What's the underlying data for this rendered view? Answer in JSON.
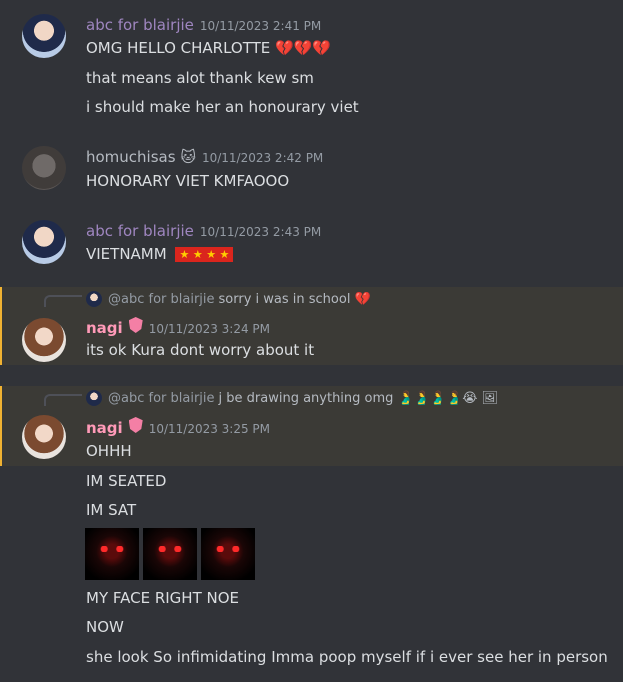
{
  "messages": [
    {
      "username": "abc for blairjie",
      "timestamp": "10/11/2023 2:41 PM",
      "lines": [
        "OMG HELLO CHARLOTTE 💔💔💔",
        "that means alot thank kew sm",
        "i should make her an honourary viet"
      ]
    },
    {
      "username": "homuchisas 🐱",
      "timestamp": "10/11/2023 2:42 PM",
      "lines": [
        "HONORARY VIET KMFAOOO"
      ]
    },
    {
      "username": "abc for blairjie",
      "timestamp": "10/11/2023 2:43 PM",
      "lines": [
        "VIETNAMM"
      ],
      "flag": "★ ★ ★ ★"
    },
    {
      "reply_mention": "@abc for blairjie",
      "reply_text": "sorry i was in school 💔",
      "username": "nagi",
      "timestamp": "10/11/2023 3:24 PM",
      "lines": [
        "its ok Kura dont worry about it"
      ]
    },
    {
      "reply_mention": "@abc for blairjie",
      "reply_text": "j be drawing anything omg 🫃🫃🫃🫃😭 🖼",
      "username": "nagi",
      "timestamp": "10/11/2023 3:25 PM",
      "lines": [
        "OHHH",
        "IM SEATED",
        "IM SAT",
        "MY FACE RIGHT NOE",
        "NOW",
        "she look So infimidating Imma poop myself if i ever see her in person"
      ]
    }
  ],
  "colors": {
    "background": "#313338",
    "highlight": "#3b3a36",
    "highlight_bar": "#f0b232",
    "nagi_name": "#ff9ab8",
    "abc_name": "#9f86c0"
  }
}
